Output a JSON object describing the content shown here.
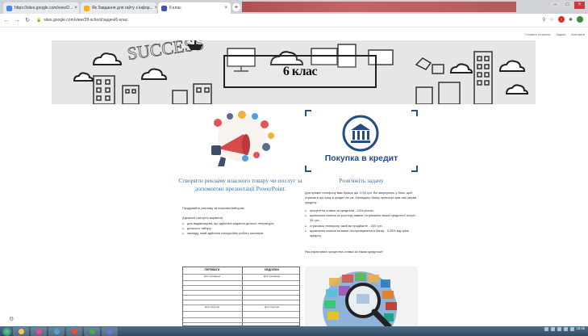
{
  "browser": {
    "tabs": [
      {
        "label": "https://sites.google.com/view/2...",
        "favicon_color": "#4285f4"
      },
      {
        "label": "Як Завдання для гайту з інфор...",
        "favicon_color": "#f4b400"
      },
      {
        "label": "6 клас",
        "favicon_color": "#3f51b5"
      }
    ],
    "new_tab_icon": "plus-icon",
    "url": "sites.google.com/view/28-school/задачі/6-клас"
  },
  "site_nav": {
    "items": [
      "Головна сторінка",
      "Задачі",
      "Контакти"
    ]
  },
  "banner": {
    "title": "6 клас"
  },
  "left": {
    "title": "Створити рекламу власного товару чи послуг за допомогою презентації PowerPoint.",
    "intro": "Продумайте рекламу за власним вибором.",
    "sub": "(Ідеальні наступні варіанти)",
    "bullets": [
      "для видавництва, що здійснює видання дитячої літератури;",
      "дитячого табору;",
      "закладу, який здійснює екскурсійну роботу школярів."
    ]
  },
  "right": {
    "badge_label": "Покупка в кредит",
    "title": "Розв'яжіть задачу",
    "intro": "Для купівлі телефону вам бракує ще 1700 грн. Ви звернулись у банк, щоб отримати цю суму в кредит на рік. Менеджер банку пропонує вам такі умови кредиту:",
    "bullets": [
      "процентна ставка за кредитом - 24% річних;",
      "щомісячна комісія за розгляд заявки і отримання вашої кредитної історії - 35 грн.;",
      "страховка телефону, який ви придбаєте - 200 грн.;",
      "щомісячна комісія за ваше обслуговування в банку - 0,25% від суми кредиту."
    ],
    "question": "Яка ефективна процентна ставка за таким кредитом?"
  },
  "table_image": {
    "headers": [
      "ПЕРЕВАГИ",
      "НЕДОЛІКИ"
    ],
    "cells": [
      "Для продавців",
      "Для продавців",
      "Для покупців",
      "Для покупців"
    ]
  },
  "taskbar": {
    "apps": [
      {
        "name": "explorer",
        "color": "#f2c94c"
      },
      {
        "name": "media",
        "color": "#e74c8c"
      },
      {
        "name": "ie",
        "color": "#4aa3df"
      },
      {
        "name": "chrome",
        "color": "#e74c3c"
      },
      {
        "name": "app5",
        "color": "#3fae49"
      },
      {
        "name": "app6",
        "color": "#5b7bd5"
      }
    ],
    "clock": {
      "time": "18:46",
      "date": "..."
    }
  },
  "colors": {
    "accent_blue": "#3a6fb0",
    "credit_blue": "#244c86"
  }
}
